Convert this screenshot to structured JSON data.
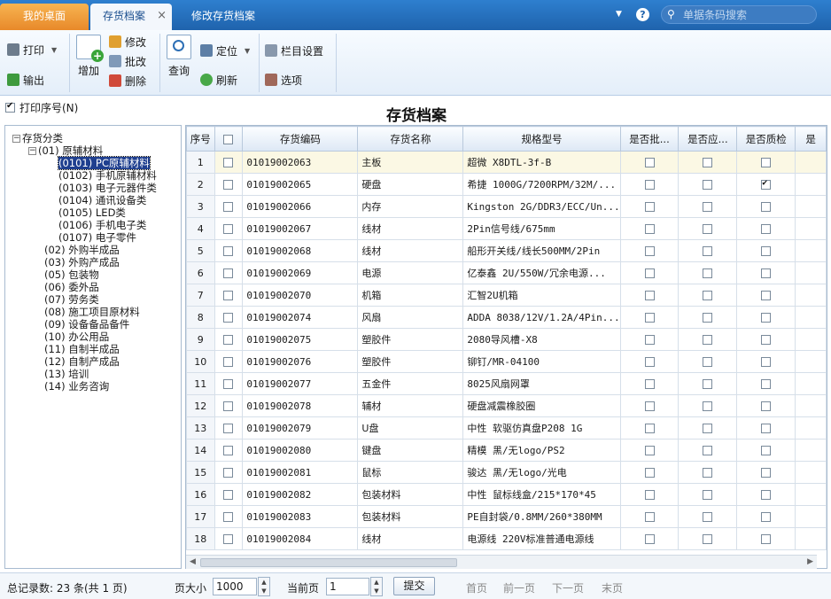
{
  "tabs": {
    "home": "我的桌面",
    "inventory": "存货档案",
    "inventory_close": "×",
    "edit": "修改存货档案"
  },
  "search": {
    "placeholder": "单据条码搜索"
  },
  "toolbar": {
    "print": "打印",
    "export": "输出",
    "add": "增加",
    "modify": "修改",
    "batch_modify": "批改",
    "delete": "删除",
    "query": "查询",
    "locate": "定位",
    "refresh": "刷新",
    "column_settings": "栏目设置",
    "options": "选项"
  },
  "option": {
    "print_serial": "打印序号(N)",
    "checked": true
  },
  "page_title": "存货档案",
  "tree": {
    "root": "存货分类",
    "n01": "(01) 原辅材料",
    "n0101": "(0101) PC原辅材料",
    "n0102": "(0102) 手机原辅材料",
    "n0103": "(0103) 电子元器件类",
    "n0104": "(0104) 通讯设备类",
    "n0105": "(0105) LED类",
    "n0106": "(0106) 手机电子类",
    "n0107": "(0107) 电子零件",
    "n02": "(02) 外购半成品",
    "n03": "(03) 外购产成品",
    "n05": "(05) 包装物",
    "n06": "(06) 委外品",
    "n07": "(07) 劳务类",
    "n08": "(08) 施工项目原材料",
    "n09": "(09) 设备备品备件",
    "n10": "(10) 办公用品",
    "n11": "(11) 自制半成品",
    "n12": "(12) 自制产成品",
    "n13": "(13) 培训",
    "n14": "(14) 业务咨询"
  },
  "grid": {
    "headers": {
      "seq": "序号",
      "code": "存货编码",
      "name": "存货名称",
      "spec": "规格型号",
      "batch": "是否批...",
      "apply": "是否应...",
      "qc": "是否质检",
      "more": "是"
    },
    "rows": [
      {
        "seq": "1",
        "code": "01019002063",
        "name": "主板",
        "spec": "超微 X8DTL-3f-B",
        "qc": false
      },
      {
        "seq": "2",
        "code": "01019002065",
        "name": "硬盘",
        "spec": "希捷 1000G/7200RPM/32M/...",
        "qc": true
      },
      {
        "seq": "3",
        "code": "01019002066",
        "name": "内存",
        "spec": "Kingston 2G/DDR3/ECC/Un...",
        "qc": false
      },
      {
        "seq": "4",
        "code": "01019002067",
        "name": "线材",
        "spec": "2Pin信号线/675mm",
        "qc": false
      },
      {
        "seq": "5",
        "code": "01019002068",
        "name": "线材",
        "spec": "船形开关线/线长500MM/2Pin",
        "qc": false
      },
      {
        "seq": "6",
        "code": "01019002069",
        "name": "电源",
        "spec": "亿泰鑫 2U/550W/冗余电源...",
        "qc": false
      },
      {
        "seq": "7",
        "code": "01019002070",
        "name": "机箱",
        "spec": "汇智2U机箱",
        "qc": false
      },
      {
        "seq": "8",
        "code": "01019002074",
        "name": "风扇",
        "spec": "ADDA 8038/12V/1.2A/4Pin...",
        "qc": false
      },
      {
        "seq": "9",
        "code": "01019002075",
        "name": "塑胶件",
        "spec": "2080导风槽-X8",
        "qc": false
      },
      {
        "seq": "10",
        "code": "01019002076",
        "name": "塑胶件",
        "spec": "铆钉/MR-04100",
        "qc": false
      },
      {
        "seq": "11",
        "code": "01019002077",
        "name": "五金件",
        "spec": "8025风扇网罩",
        "qc": false
      },
      {
        "seq": "12",
        "code": "01019002078",
        "name": "辅材",
        "spec": "硬盘减震橡胶圈",
        "qc": false
      },
      {
        "seq": "13",
        "code": "01019002079",
        "name": "U盘",
        "spec": "中性 软驱仿真盘P208 1G",
        "qc": false
      },
      {
        "seq": "14",
        "code": "01019002080",
        "name": "键盘",
        "spec": "精模 黑/无logo/PS2",
        "qc": false
      },
      {
        "seq": "15",
        "code": "01019002081",
        "name": "鼠标",
        "spec": "骏达 黑/无logo/光电",
        "qc": false
      },
      {
        "seq": "16",
        "code": "01019002082",
        "name": "包装材料",
        "spec": "中性 鼠标线盒/215*170*45",
        "qc": false
      },
      {
        "seq": "17",
        "code": "01019002083",
        "name": "包装材料",
        "spec": "PE自封袋/0.8MM/260*380MM",
        "qc": false
      },
      {
        "seq": "18",
        "code": "01019002084",
        "name": "线材",
        "spec": "电源线 220V标准普通电源线",
        "qc": false
      }
    ]
  },
  "footer": {
    "total": "总记录数: 23 条(共 1 页)",
    "page_size_label": "页大小",
    "page_size": "1000",
    "current_label": "当前页",
    "current": "1",
    "submit": "提交",
    "first": "首页",
    "prev": "前一页",
    "next": "下一页",
    "last": "末页"
  }
}
